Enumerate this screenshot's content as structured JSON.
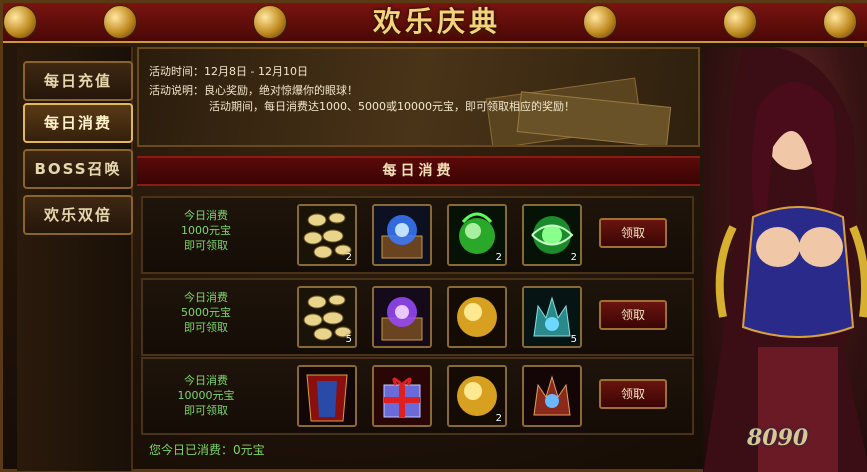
{
  "banner": {
    "title": "欢乐庆典"
  },
  "tabs": [
    {
      "label": "每日充值",
      "active": false
    },
    {
      "label": "每日消费",
      "active": true
    },
    {
      "label": "BOSS召唤",
      "active": false
    },
    {
      "label": "欢乐双倍",
      "active": false
    }
  ],
  "info": {
    "time_label": "活动时间：",
    "time_value": "12月8日 - 12月10日",
    "desc_label": "活动说明：",
    "desc_line1": "良心奖励，绝对惊爆你的眼球！",
    "desc_line2": "活动期间，每日消费达1000、5000或10000元宝，即可领取相应的奖励！"
  },
  "section": {
    "title": "每日消费"
  },
  "rows": [
    {
      "req": [
        "今日消费",
        "1000元宝",
        "即可领取"
      ],
      "items": [
        {
          "icon": "gold-ingots-icon",
          "count": "2"
        },
        {
          "icon": "blue-orb-chest-icon",
          "count": ""
        },
        {
          "icon": "green-flame-orb-icon",
          "count": "2"
        },
        {
          "icon": "green-swirl-orb-icon",
          "count": "2"
        }
      ],
      "claim": "领取"
    },
    {
      "req": [
        "今日消费",
        "5000元宝",
        "即可领取"
      ],
      "items": [
        {
          "icon": "gold-ingots-icon",
          "count": "5"
        },
        {
          "icon": "purple-orb-chest-icon",
          "count": ""
        },
        {
          "icon": "gold-orb-icon",
          "count": ""
        },
        {
          "icon": "teal-crown-gem-icon",
          "count": "5"
        }
      ],
      "claim": "领取"
    },
    {
      "req": [
        "今日消费",
        "10000元宝",
        "即可领取"
      ],
      "items": [
        {
          "icon": "blue-cloak-icon",
          "count": ""
        },
        {
          "icon": "red-gift-box-icon",
          "count": ""
        },
        {
          "icon": "gold-orb-icon",
          "count": "2"
        },
        {
          "icon": "red-crown-gem-icon",
          "count": ""
        }
      ],
      "claim": "领取"
    }
  ],
  "footer": {
    "today_spent": "您今日已消费：0元宝"
  },
  "watermark": {
    "text": "8090"
  }
}
